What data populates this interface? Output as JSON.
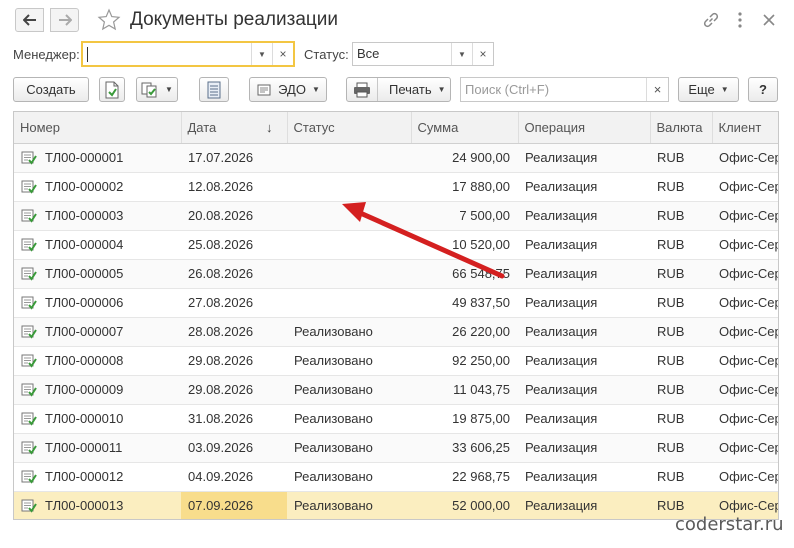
{
  "window": {
    "title": "Документы реализации"
  },
  "filters": {
    "manager_label": "Менеджер:",
    "manager_value": "",
    "status_label": "Статус:",
    "status_value": "Все"
  },
  "toolbar": {
    "create_label": "Создать",
    "edo_label": "ЭДО",
    "print_label": "Печать",
    "search_placeholder": "Поиск (Ctrl+F)",
    "more_label": "Еще",
    "help_label": "?"
  },
  "table": {
    "columns": [
      "Номер",
      "Дата",
      "Статус",
      "Сумма",
      "Операция",
      "Валюта",
      "Клиент"
    ],
    "sort_indicator": "↓",
    "rows": [
      {
        "number": "ТЛ00-000001",
        "date": "17.07.2026",
        "status": "",
        "sum": "24 900,00",
        "operation": "Реализация",
        "currency": "RUB",
        "client": "Офис-Сер"
      },
      {
        "number": "ТЛ00-000002",
        "date": "12.08.2026",
        "status": "",
        "sum": "17 880,00",
        "operation": "Реализация",
        "currency": "RUB",
        "client": "Офис-Сер"
      },
      {
        "number": "ТЛ00-000003",
        "date": "20.08.2026",
        "status": "",
        "sum": "7 500,00",
        "operation": "Реализация",
        "currency": "RUB",
        "client": "Офис-Сер"
      },
      {
        "number": "ТЛ00-000004",
        "date": "25.08.2026",
        "status": "",
        "sum": "10 520,00",
        "operation": "Реализация",
        "currency": "RUB",
        "client": "Офис-Сер"
      },
      {
        "number": "ТЛ00-000005",
        "date": "26.08.2026",
        "status": "",
        "sum": "66 548,75",
        "operation": "Реализация",
        "currency": "RUB",
        "client": "Офис-Сер"
      },
      {
        "number": "ТЛ00-000006",
        "date": "27.08.2026",
        "status": "",
        "sum": "49 837,50",
        "operation": "Реализация",
        "currency": "RUB",
        "client": "Офис-Сер"
      },
      {
        "number": "ТЛ00-000007",
        "date": "28.08.2026",
        "status": "Реализовано",
        "sum": "26 220,00",
        "operation": "Реализация",
        "currency": "RUB",
        "client": "Офис-Сер"
      },
      {
        "number": "ТЛ00-000008",
        "date": "29.08.2026",
        "status": "Реализовано",
        "sum": "92 250,00",
        "operation": "Реализация",
        "currency": "RUB",
        "client": "Офис-Сер"
      },
      {
        "number": "ТЛ00-000009",
        "date": "29.08.2026",
        "status": "Реализовано",
        "sum": "11 043,75",
        "operation": "Реализация",
        "currency": "RUB",
        "client": "Офис-Сер"
      },
      {
        "number": "ТЛ00-000010",
        "date": "31.08.2026",
        "status": "Реализовано",
        "sum": "19 875,00",
        "operation": "Реализация",
        "currency": "RUB",
        "client": "Офис-Сер"
      },
      {
        "number": "ТЛ00-000011",
        "date": "03.09.2026",
        "status": "Реализовано",
        "sum": "33 606,25",
        "operation": "Реализация",
        "currency": "RUB",
        "client": "Офис-Сер"
      },
      {
        "number": "ТЛ00-000012",
        "date": "04.09.2026",
        "status": "Реализовано",
        "sum": "22 968,75",
        "operation": "Реализация",
        "currency": "RUB",
        "client": "Офис-Сер"
      },
      {
        "number": "ТЛ00-000013",
        "date": "07.09.2026",
        "status": "Реализовано",
        "sum": "52 000,00",
        "operation": "Реализация",
        "currency": "RUB",
        "client": "Офис-Сер"
      }
    ]
  },
  "watermark": "coderstar.ru",
  "colors": {
    "focus_border": "#f3c643",
    "selected_row": "#fbeec0",
    "annotation_arrow": "#d42020",
    "doc_icon_check": "#3a9a3a"
  }
}
